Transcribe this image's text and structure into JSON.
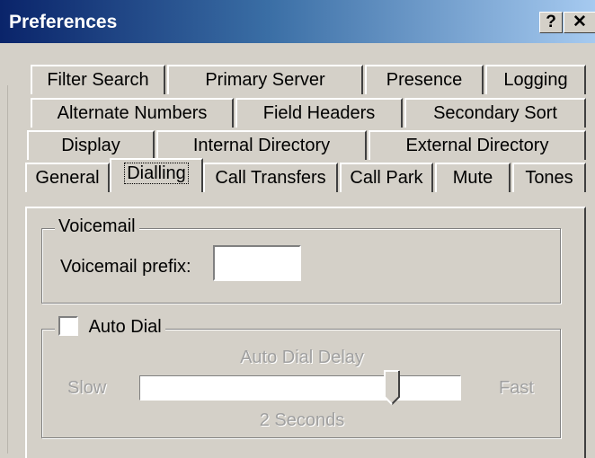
{
  "window": {
    "title": "Preferences",
    "help_button": "?",
    "close_button": "✕"
  },
  "tabs": {
    "row1": [
      "Filter Search",
      "Primary Server",
      "Presence",
      "Logging"
    ],
    "row2": [
      "Alternate Numbers",
      "Field Headers",
      "Secondary Sort"
    ],
    "row3": [
      "Display",
      "Internal Directory",
      "External Directory"
    ],
    "row4": [
      "General",
      "Dialling",
      "Call Transfers",
      "Call Park",
      "Mute",
      "Tones"
    ],
    "active": "Dialling"
  },
  "voicemail": {
    "group_label": "Voicemail",
    "prefix_label": "Voicemail prefix:",
    "prefix_value": ""
  },
  "auto_dial": {
    "checkbox_label": "Auto Dial",
    "checked": false,
    "delay_label": "Auto Dial Delay",
    "slow_label": "Slow",
    "fast_label": "Fast",
    "delay_value_text": "2 Seconds",
    "slider_level": 0.8,
    "enabled": false
  },
  "colors": {
    "title_start": "#0a246a",
    "title_end": "#a6caf0",
    "face": "#d4d0c8"
  }
}
